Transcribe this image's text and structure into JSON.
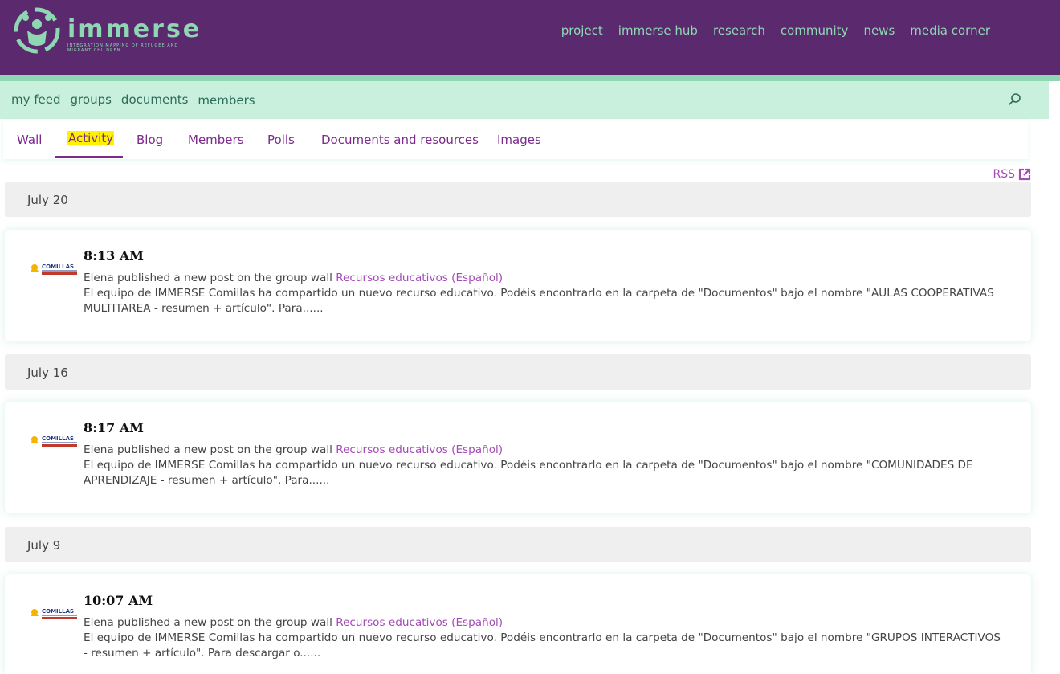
{
  "site": {
    "brand": "immerse",
    "tagline": "INTEGRATION MAPPING OF REFUGEE AND MIGRANT CHILDREN",
    "nav": [
      "project",
      "immerse hub",
      "research",
      "community",
      "news",
      "media corner"
    ],
    "colors": {
      "header": "#5b2a6e",
      "accent": "#8fd6b3",
      "subbar": "#c9f0dd",
      "link": "#a34bb6"
    }
  },
  "subnav": [
    "my feed",
    "groups",
    "documents",
    "members"
  ],
  "tabs": [
    "Wall",
    "Activity",
    "Blog",
    "Members",
    "Polls",
    "Documents and resources",
    "Images"
  ],
  "active_tab": "Activity",
  "rss": "RSS",
  "feed": [
    {
      "date": "July 20",
      "time": "8:13 AM",
      "avatar_label": "COMILLAS",
      "actor": "Elena published a new post on the group wall",
      "group": "Recursos educativos (Español)",
      "text": "El equipo de IMMERSE Comillas ha compartido un nuevo recurso educativo. Podéis encontrarlo en la carpeta de \"Documentos\" bajo el nombre \"AULAS COOPERATIVAS MULTITAREA - resumen + artículo\". Para......"
    },
    {
      "date": "July 16",
      "time": "8:17 AM",
      "avatar_label": "COMILLAS",
      "actor": "Elena published a new post on the group wall",
      "group": "Recursos educativos (Español)",
      "text": "El equipo de IMMERSE Comillas ha compartido un nuevo recurso educativo. Podéis encontrarlo en la carpeta de \"Documentos\" bajo el nombre \"COMUNIDADES DE APRENDIZAJE - resumen + artículo\". Para......"
    },
    {
      "date": "July 9",
      "time": "10:07 AM",
      "avatar_label": "COMILLAS",
      "actor": "Elena published a new post on the group wall",
      "group": "Recursos educativos (Español)",
      "text": "El equipo de IMMERSE Comillas ha compartido un nuevo recurso educativo. Podéis encontrarlo en la carpeta de \"Documentos\" bajo el nombre \"GRUPOS INTERACTIVOS - resumen + artículo\". Para descargar o......"
    }
  ]
}
